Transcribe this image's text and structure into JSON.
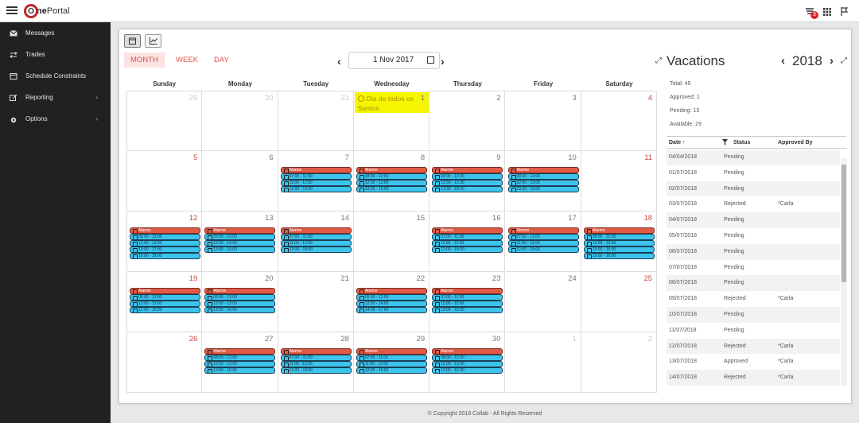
{
  "app": {
    "logo_o": "O",
    "logo_ne": "ne",
    "logo_portal": "Portal",
    "notification_count": "3"
  },
  "sidebar": {
    "items": [
      {
        "label": "Messages",
        "icon": "envelope-icon",
        "chevron": ""
      },
      {
        "label": "Trades",
        "icon": "exchange-icon",
        "chevron": ""
      },
      {
        "label": "Schedule Constraints",
        "icon": "calendar-icon",
        "chevron": ""
      },
      {
        "label": "Reporting",
        "icon": "edit-icon",
        "chevron": "›"
      },
      {
        "label": "Options",
        "icon": "gear-icon",
        "chevron": "›"
      }
    ]
  },
  "calendar": {
    "tabs": [
      "MONTH",
      "WEEK",
      "DAY"
    ],
    "active_tab": "MONTH",
    "current_date": "1 Nov 2017",
    "prev": "‹",
    "next": "›",
    "weekdays": [
      "Sunday",
      "Monday",
      "Tuesday",
      "Wednesday",
      "Thursday",
      "Friday",
      "Saturday"
    ],
    "holiday": "Dia de todos os Santos",
    "weeks": [
      [
        {
          "d": "29",
          "t": "other"
        },
        {
          "d": "30",
          "t": "other"
        },
        {
          "d": "31",
          "t": "other"
        },
        {
          "d": "1",
          "t": "hol"
        },
        {
          "d": "2"
        },
        {
          "d": "3"
        },
        {
          "d": "4",
          "t": "we"
        }
      ],
      [
        {
          "d": "5",
          "t": "we"
        },
        {
          "d": "6"
        },
        {
          "d": "7",
          "ev": [
            "Alarme",
            "07:00 - 11:00",
            "11:00 - 12:00",
            "12:00 - 13:00"
          ]
        },
        {
          "d": "8",
          "ev": [
            "Alarme",
            "08:00 - 12:00",
            "12:00 - 13:00",
            "13:00 - 16:00"
          ]
        },
        {
          "d": "9",
          "ev": [
            "Alarme",
            "08:00 - 12:00",
            "12:30 - 13:30",
            "13:30 - 18:00"
          ]
        },
        {
          "d": "10",
          "ev": [
            "Alarme",
            "08:00 - 12:00",
            "12:00 - 13:00",
            "13:00 - 18:00"
          ]
        },
        {
          "d": "11",
          "t": "we"
        }
      ],
      [
        {
          "d": "12",
          "t": "we",
          "ev": [
            "Alarme",
            "08:00 - 12:00",
            "12:00 - 13:00",
            "13:00 - 17:00",
            "18:00 - 18:00"
          ]
        },
        {
          "d": "13",
          "ev": [
            "Alarme",
            "09:00 - 12:00",
            "12:00 - 13:00",
            "13:00 - 15:00"
          ]
        },
        {
          "d": "14",
          "ev": [
            "Alarme",
            "07:00 - 11:00",
            "11:00 - 12:00",
            "12:00 - 15:00"
          ]
        },
        {
          "d": "15"
        },
        {
          "d": "16",
          "ev": [
            "Alarme",
            "07:00 - 11:00",
            "11:00 - 12:00",
            "12:00 - 15:00"
          ]
        },
        {
          "d": "17",
          "ev": [
            "Alarme",
            "07:00 - 11:00",
            "11:00 - 12:00",
            "12:00 - 15:00"
          ]
        },
        {
          "d": "18",
          "t": "we",
          "ev": [
            "Alarme",
            "08:00 - 12:00",
            "12:00 - 13:00",
            "13:00 - 15:00",
            "16:00 - 18:00"
          ]
        }
      ],
      [
        {
          "d": "19",
          "t": "we",
          "ev": [
            "Alarme",
            "08:00 - 12:00",
            "12:00 - 13:00",
            "13:00 - 16:00"
          ]
        },
        {
          "d": "20",
          "ev": [
            "Alarme",
            "09:00 - 12:00",
            "12:00 - 13:00",
            "13:00 - 16:00"
          ]
        },
        {
          "d": "21"
        },
        {
          "d": "22",
          "ev": [
            "Alarme",
            "09:00 - 12:00",
            "12:00 - 14:00",
            "14:00 - 17:00"
          ]
        },
        {
          "d": "23",
          "ev": [
            "Alarme",
            "07:00 - 11:00",
            "11:00 - 12:00",
            "12:00 - 15:00"
          ]
        },
        {
          "d": "24"
        },
        {
          "d": "25",
          "t": "we"
        }
      ],
      [
        {
          "d": "26",
          "t": "we"
        },
        {
          "d": "27",
          "ev": [
            "Alarme",
            "08:00 - 12:00",
            "12:00 - 13:00",
            "13:00 - 16:00"
          ]
        },
        {
          "d": "28",
          "ev": [
            "Alarme",
            "07:00 - 11:00",
            "11:00 - 12:00",
            "12:00 - 16:00"
          ]
        },
        {
          "d": "29",
          "ev": [
            "Alarme",
            "07:00 - 11:00",
            "11:00 - 12:00",
            "12:00 - 15:00"
          ]
        },
        {
          "d": "30",
          "ev": [
            "Alarme",
            "08:00 - 12:00",
            "12:00 - 13:00",
            "13:00 - 16:00"
          ]
        },
        {
          "d": "1",
          "t": "other"
        },
        {
          "d": "2",
          "t": "other"
        }
      ]
    ]
  },
  "vacations": {
    "title": "Vacations",
    "year": "2018",
    "prev": "‹",
    "next": "›",
    "total": "Total: 45",
    "approved": "Approved: 1",
    "pending": "Pending: 15",
    "available": "Available: 29",
    "columns": {
      "date": "Date",
      "status": "Status",
      "approved_by": "Approved By"
    },
    "rows": [
      [
        "04/04/2018",
        "Pending",
        ""
      ],
      [
        "01/07/2018",
        "Pending",
        ""
      ],
      [
        "02/07/2018",
        "Pending",
        ""
      ],
      [
        "03/07/2018",
        "Rejected",
        "*Carla"
      ],
      [
        "04/07/2018",
        "Pending",
        ""
      ],
      [
        "05/07/2018",
        "Pending",
        ""
      ],
      [
        "06/07/2018",
        "Pending",
        ""
      ],
      [
        "07/07/2018",
        "Pending",
        ""
      ],
      [
        "08/07/2018",
        "Pending",
        ""
      ],
      [
        "09/07/2018",
        "Rejected",
        "*Carla"
      ],
      [
        "10/07/2018",
        "Pending",
        ""
      ],
      [
        "11/07/2018",
        "Pending",
        ""
      ],
      [
        "12/07/2018",
        "Rejected",
        "*Carla"
      ],
      [
        "13/07/2018",
        "Approved",
        "*Carla"
      ],
      [
        "14/07/2018",
        "Rejected",
        "*Carla"
      ]
    ]
  },
  "footer": "© Copyright 2018 Collab - All Rights Reserved"
}
